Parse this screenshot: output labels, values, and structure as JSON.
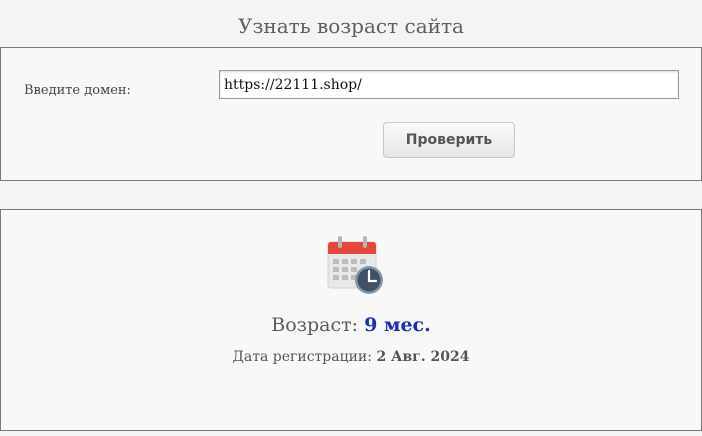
{
  "header": {
    "title": "Узнать возраст сайта"
  },
  "form": {
    "domain_label": "Введите домен:",
    "domain_value": "https://22111.shop/",
    "check_button": "Проверить"
  },
  "result": {
    "icon": "calendar-clock-icon",
    "age_label": "Возраст:",
    "age_value": "9 мес.",
    "reg_label": "Дата регистрации:",
    "reg_value": "2 Авг. 2024"
  },
  "colors": {
    "age_value": "#1b2fb0",
    "calendar_header": "#e5463d",
    "clock": "#3f5164"
  }
}
